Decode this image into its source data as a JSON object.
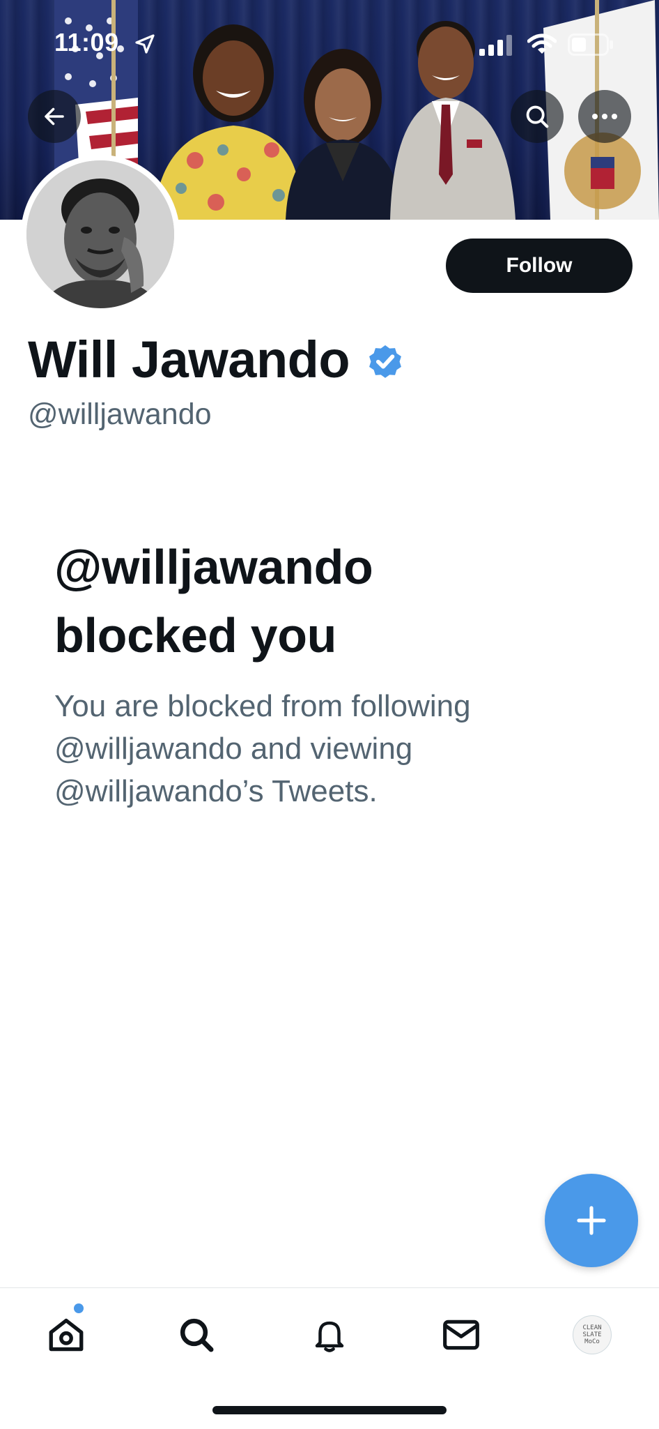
{
  "status_bar": {
    "time": "11:09"
  },
  "header": {
    "back_icon": "back-arrow-icon",
    "search_icon": "search-icon",
    "more_icon": "more-options-icon"
  },
  "profile": {
    "display_name": "Will Jawando",
    "handle": "@willjawando",
    "verified": true,
    "follow_label": "Follow"
  },
  "blocked": {
    "title_line1": "@willjawando",
    "title_line2": "blocked you",
    "description_line1": "You are blocked from following",
    "description_line2": "@willjawando and viewing",
    "description_line3": "@willjawando’s Tweets."
  },
  "compose_button": {
    "icon": "plus-icon"
  },
  "bottom_nav": {
    "items": [
      "home-icon",
      "search-icon",
      "notifications-bell-icon",
      "messages-envelope-icon",
      "profile-avatar"
    ],
    "home_has_new": true,
    "profile_avatar_text": [
      "CLEAN",
      "SLATE",
      "MoCo"
    ]
  },
  "colors": {
    "accent": "#4a99e9",
    "text_primary": "#0f1419",
    "text_secondary": "#536471",
    "follow_button_bg": "#0f1419"
  }
}
